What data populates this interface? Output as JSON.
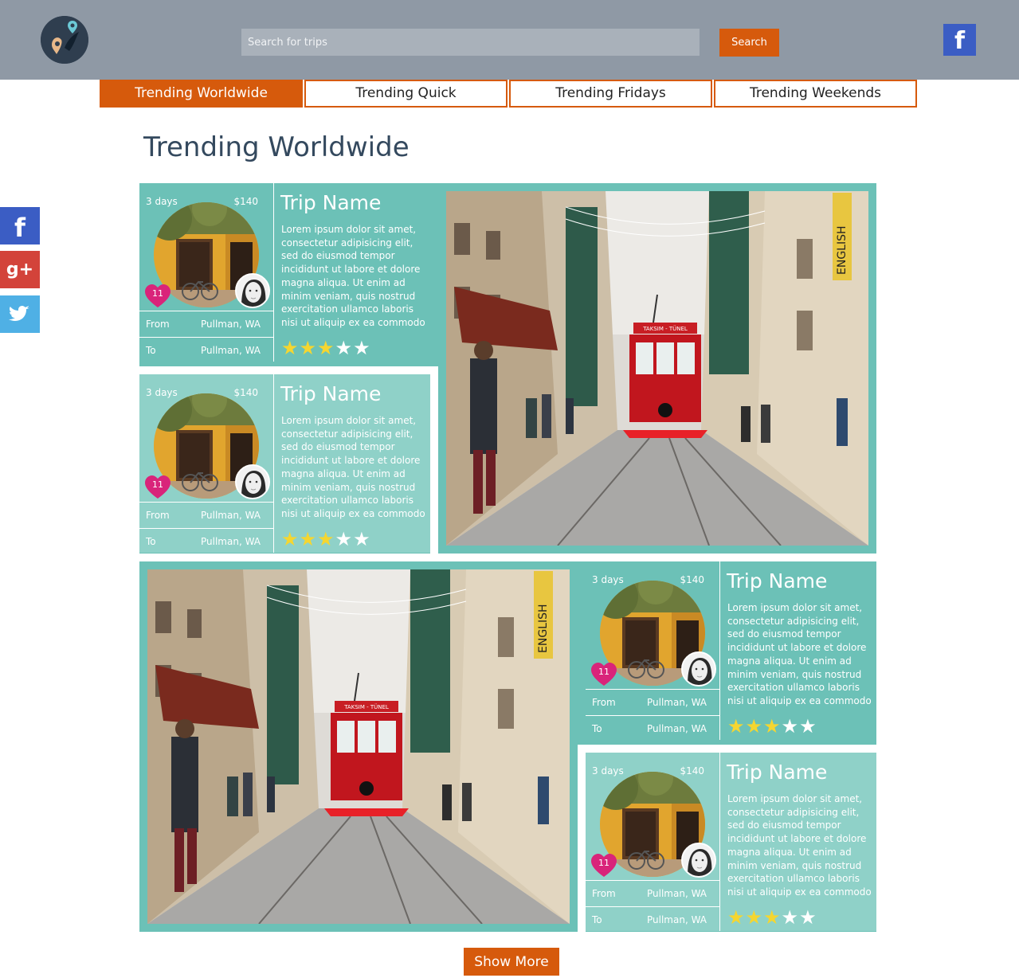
{
  "header": {
    "search_placeholder": "Search for trips",
    "search_label": "Search",
    "facebook_glyph": "f"
  },
  "tabs": [
    {
      "label": "Trending Worldwide",
      "active": true
    },
    {
      "label": "Trending Quick",
      "active": false
    },
    {
      "label": "Trending Fridays",
      "active": false
    },
    {
      "label": "Trending Weekends",
      "active": false
    }
  ],
  "page_title": "Trending Worldwide",
  "social": {
    "facebook": "f",
    "google_plus": "g+",
    "twitter": "twitter-icon"
  },
  "colors": {
    "accent": "#d65a0c",
    "card": "#6cc1b7",
    "card_light": "#8fd1c8",
    "header": "#8f99a5"
  },
  "cards": [
    {
      "days": "3 days",
      "price": "$140",
      "likes": "11",
      "from_label": "From",
      "from": "Pullman, WA",
      "to_label": "To",
      "to": "Pullman, WA",
      "name": "Trip Name",
      "description": "Lorem ipsum dolor sit amet, consectetur adipisicing elit, sed do eiusmod tempor incididunt ut labore et dolore magna aliqua. Ut enim ad minim veniam, quis nostrud exercitation ullamco laboris nisi ut aliquip ex ea commodo",
      "rating": 3,
      "rating_max": 5
    },
    {
      "days": "3 days",
      "price": "$140",
      "likes": "11",
      "from_label": "From",
      "from": "Pullman, WA",
      "to_label": "To",
      "to": "Pullman, WA",
      "name": "Trip Name",
      "description": "Lorem ipsum dolor sit amet, consectetur adipisicing elit, sed do eiusmod tempor incididunt ut labore et dolore magna aliqua. Ut enim ad minim veniam, quis nostrud exercitation ullamco laboris nisi ut aliquip ex ea commodo",
      "rating": 3,
      "rating_max": 5
    },
    {
      "days": "3 days",
      "price": "$140",
      "likes": "11",
      "from_label": "From",
      "from": "Pullman, WA",
      "to_label": "To",
      "to": "Pullman, WA",
      "name": "Trip Name",
      "description": "Lorem ipsum dolor sit amet, consectetur adipisicing elit, sed do eiusmod tempor incididunt ut labore et dolore magna aliqua. Ut enim ad minim veniam, quis nostrud exercitation ullamco laboris nisi ut aliquip ex ea commodo",
      "rating": 3,
      "rating_max": 5
    },
    {
      "days": "3 days",
      "price": "$140",
      "likes": "11",
      "from_label": "From",
      "from": "Pullman, WA",
      "to_label": "To",
      "to": "Pullman, WA",
      "name": "Trip Name",
      "description": "Lorem ipsum dolor sit amet, consectetur adipisicing elit, sed do eiusmod tempor incididunt ut labore et dolore magna aliqua. Ut enim ad minim veniam, quis nostrud exercitation ullamco laboris nisi ut aliquip ex ea commodo",
      "rating": 3,
      "rating_max": 5
    }
  ],
  "photo_sign": "ENGLISH",
  "tram_sign": "TAKSIM - TÜNEL",
  "show_more_label": "Show More"
}
